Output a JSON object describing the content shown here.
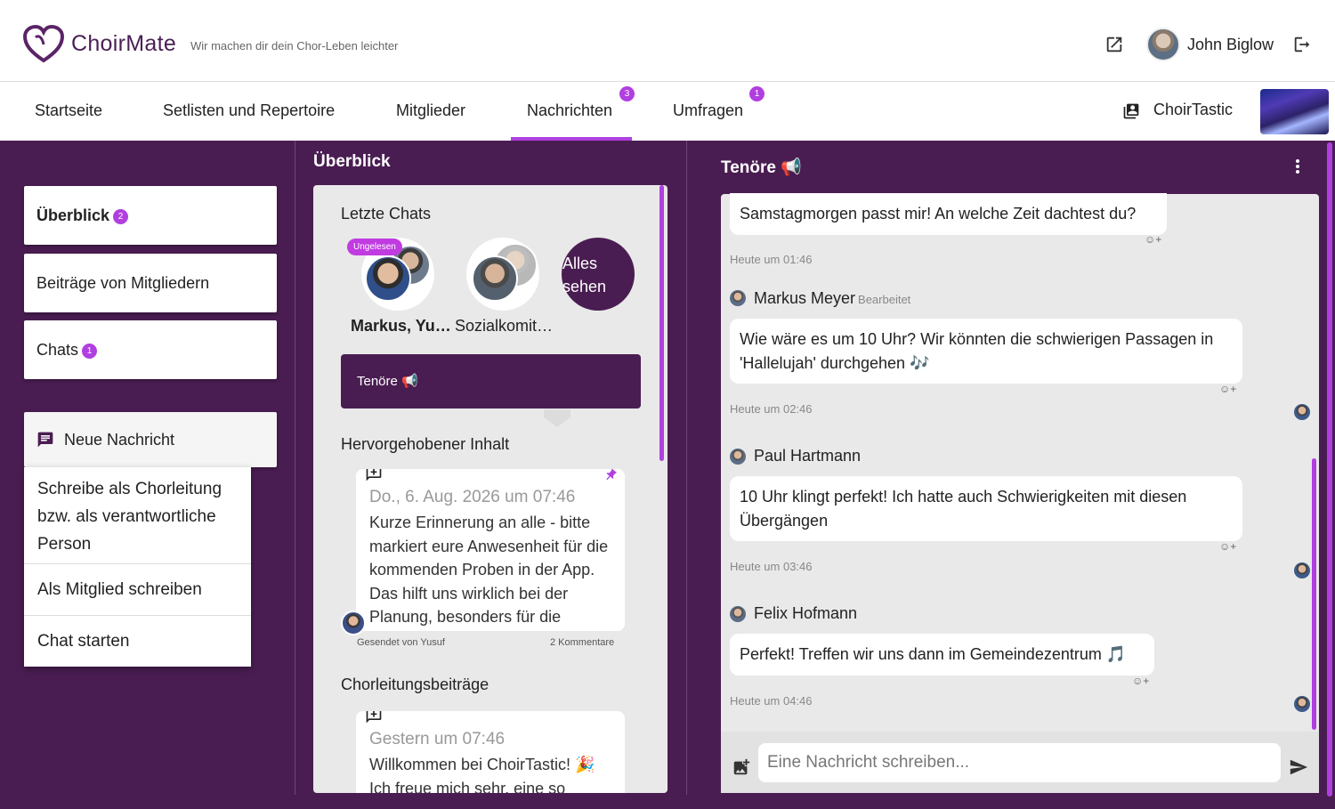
{
  "header": {
    "brand": "ChoirMate",
    "tagline": "Wir machen dir dein Chor-Leben leichter",
    "user_name": "John Biglow"
  },
  "nav": {
    "tabs": [
      {
        "label": "Startseite"
      },
      {
        "label": "Setlisten und Repertoire"
      },
      {
        "label": "Mitglieder"
      },
      {
        "label": "Nachrichten",
        "badge": "3"
      },
      {
        "label": "Umfragen",
        "badge": "1"
      }
    ],
    "choir_name": "ChoirTastic"
  },
  "sidebar": {
    "items": [
      {
        "label": "Überblick",
        "badge": "2"
      },
      {
        "label": "Beiträge von Mitgliedern"
      },
      {
        "label": "Chats",
        "badge": "1"
      }
    ],
    "new_message_label": "Neue Nachricht",
    "menu": [
      {
        "label": "Schreibe als Chorleitung bzw. als verantwortliche Person"
      },
      {
        "label": "Als Mitglied schreiben"
      },
      {
        "label": "Chat starten"
      }
    ]
  },
  "overview": {
    "title": "Überblick",
    "recent_chats_heading": "Letzte Chats",
    "unread_label": "Ungelesen",
    "recent_chats": [
      {
        "name": "Markus, Yu…"
      },
      {
        "name": "Sozialkomit…"
      }
    ],
    "see_all_label": "Alles sehen",
    "channel_label": "Tenöre 📢",
    "highlighted_heading": "Hervorgehobener Inhalt",
    "highlighted_post": {
      "date": "Do., 6. Aug. 2026 um 07:46",
      "text": "Kurze Erinnerung an alle - bitte markiert eure Anwesenheit für die kommenden Proben in der App. Das hilft uns wirklich bei der Planung, besonders für die",
      "sent_by": "Gesendet von Yusuf",
      "comments": "2 Kommentare"
    },
    "leader_posts_heading": "Chorleitungsbeiträge",
    "leader_post": {
      "date": "Gestern um 07:46",
      "text": "Willkommen bei ChoirTastic! 🎉 Ich freue mich sehr, eine so"
    }
  },
  "chat": {
    "title": "Tenöre 📢",
    "messages": [
      {
        "sender": "",
        "text": "Samstagmorgen passt mir! An welche Zeit dachtest du?",
        "time": "Heute um 01:46"
      },
      {
        "sender": "Markus Meyer",
        "edited": "Bearbeitet",
        "text": "Wie wäre es um 10 Uhr? Wir könnten die schwierigen Passagen in 'Hallelujah' durchgehen 🎶",
        "time": "Heute um 02:46"
      },
      {
        "sender": "Paul Hartmann",
        "text": "10 Uhr klingt perfekt! Ich hatte auch Schwierigkeiten mit diesen Übergängen",
        "time": "Heute um 03:46"
      },
      {
        "sender": "Felix Hofmann",
        "text": "Perfekt! Treffen wir uns dann im Gemeindezentrum 🎵",
        "time": "Heute um 04:46"
      }
    ],
    "reaction_label": "☺+",
    "input_placeholder": "Eine Nachricht schreiben..."
  },
  "colors": {
    "accent": "#b03fe0",
    "brand_dark": "#4a1d52",
    "panel_bg": "#e9e9e9"
  }
}
